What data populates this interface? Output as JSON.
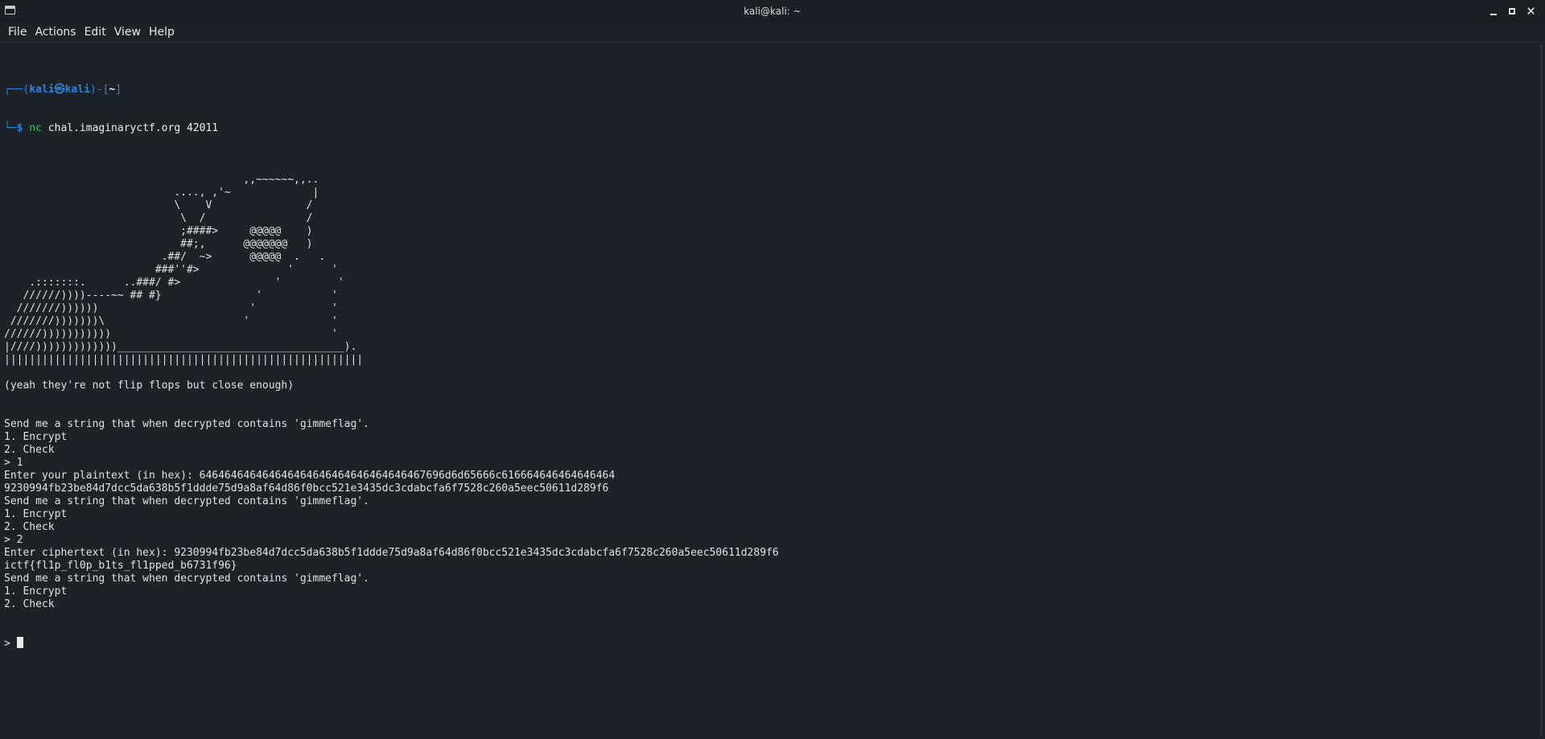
{
  "window": {
    "title": "kali@kali: ~",
    "icon": "terminal-icon",
    "controls": [
      "minimize-icon",
      "maximize-icon",
      "close-icon"
    ]
  },
  "menu": [
    "File",
    "Actions",
    "Edit",
    "View",
    "Help"
  ],
  "prompt": {
    "corner_top": "┌──(",
    "user_host": "kali㉿kali",
    "mid": ")-[",
    "cwd": "~",
    "end": "]",
    "corner_bottom": "└─",
    "dollar": "$ ",
    "command_name": "nc",
    "command_args": " chal.imaginaryctf.org 42011"
  },
  "output_lines": [
    "",
    "                                      ,,~~~~~~,,..",
    "                           ...., ,'~             |",
    "                           \\    V               /",
    "                            \\  /                /",
    "                            ;####>     @@@@@    )",
    "                            ##;,      @@@@@@@   )",
    "                         .##/  ~>      @@@@@  .   .",
    "                        ###''#>              '      '",
    "    .:::::::.      ..###/ #>               '         '",
    "   //////))))----~~ ## #}               '           '",
    "  ///////))))))                        '            '",
    " ///////)))))))\\                      '             '",
    "//////)))))))))))                                   '",
    "|////)))))))))))))____________________________________).",
    "|||||||||||||||||||||||||||||||||||||||||||||||||||||||||",
    "",
    "(yeah they're not flip flops but close enough)",
    "",
    "",
    "Send me a string that when decrypted contains 'gimmeflag'.",
    "1. Encrypt",
    "2. Check",
    "> 1",
    "Enter your plaintext (in hex): 646464646464646464646464646464646467696d6d65666c616664646464646464",
    "9230994fb23be84d7dcc5da638b5f1ddde75d9a8af64d86f0bcc521e3435dc3cdabcfa6f7528c260a5eec50611d289f6",
    "Send me a string that when decrypted contains 'gimmeflag'.",
    "1. Encrypt",
    "2. Check",
    "> 2",
    "Enter ciphertext (in hex): 9230994fb23be84d7dcc5da638b5f1ddde75d9a8af64d86f0bcc521e3435dc3cdabcfa6f7528c260a5eec50611d289f6",
    "ictf{fl1p_fl0p_b1ts_fl1pped_b6731f96}",
    "Send me a string that when decrypted contains 'gimmeflag'.",
    "1. Encrypt",
    "2. Check"
  ],
  "input_prompt": "> "
}
